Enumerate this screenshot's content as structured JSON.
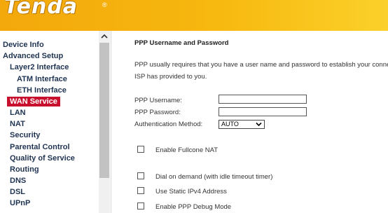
{
  "header": {
    "brand": "Tenda",
    "reg_mark": "®"
  },
  "sidebar": {
    "items": [
      {
        "label": "Device Info"
      },
      {
        "label": "Advanced Setup"
      },
      {
        "label": "Layer2 Interface"
      },
      {
        "label": "ATM Interface"
      },
      {
        "label": "ETH Interface"
      },
      {
        "label": "WAN Service",
        "active": true
      },
      {
        "label": "LAN"
      },
      {
        "label": "NAT"
      },
      {
        "label": "Security"
      },
      {
        "label": "Parental Control"
      },
      {
        "label": "Quality of Service"
      },
      {
        "label": "Routing"
      },
      {
        "label": "DNS"
      },
      {
        "label": "DSL"
      },
      {
        "label": "UPnP"
      }
    ],
    "scroll_up_icon": "chevron-up-icon"
  },
  "main": {
    "title": "PPP Username and Password",
    "description_line1": "PPP usually requires that you have a user name and password to establish your connection. In the boxes below, enter the user name and password that your",
    "description_line2": "ISP has provided to you.",
    "username_label": "PPP Username:",
    "username_value": "",
    "password_label": "PPP Password:",
    "password_value": "",
    "auth_label": "Authentication Method:",
    "auth_value": "AUTO",
    "checkboxes": [
      {
        "label": "Enable Fullcone NAT",
        "checked": false
      },
      {
        "label": "Dial on demand (with idle timeout timer)",
        "checked": false
      },
      {
        "label": "Use Static IPv4 Address",
        "checked": false
      },
      {
        "label": "Enable PPP Debug Mode",
        "checked": false
      }
    ]
  },
  "colors": {
    "header_orange": "#f7b80f",
    "active_item": "#c8102e",
    "nav_text": "#1f3352"
  }
}
